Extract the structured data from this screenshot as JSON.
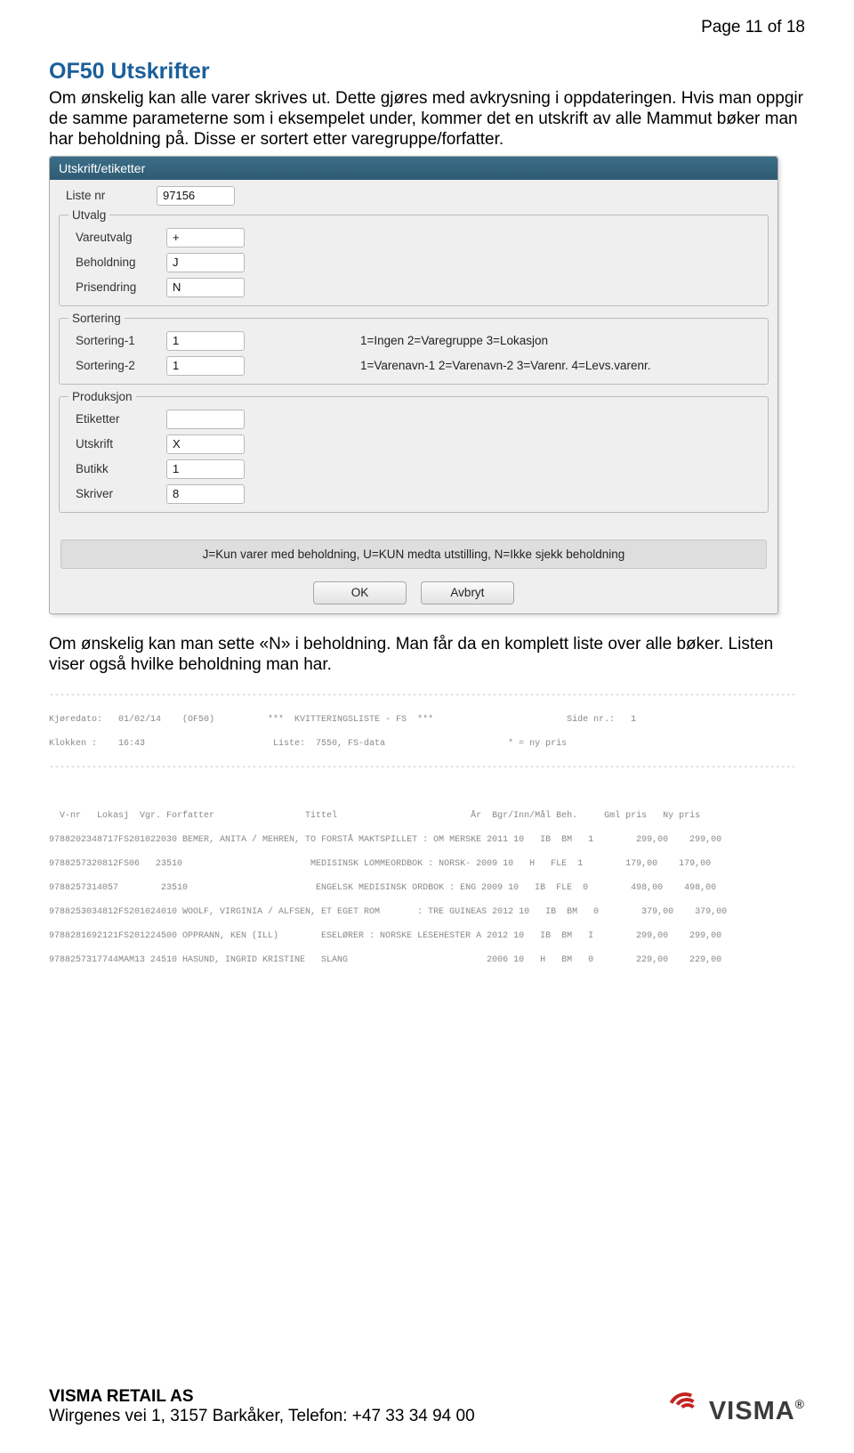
{
  "page_indicator": "Page 11 of 18",
  "heading": "OF50 Utskrifter",
  "para_top": "Om ønskelig kan alle varer skrives ut. Dette gjøres med avkrysning i oppdateringen. Hvis man oppgir de samme parameterne som i eksempelet under, kommer det en utskrift av alle Mammut bøker man har beholdning på. Disse er sortert etter varegruppe/forfatter.",
  "dialog": {
    "title": "Utskrift/etiketter",
    "liste_nr_label": "Liste nr",
    "liste_nr_value": "97156",
    "group_utvalg": {
      "legend": "Utvalg",
      "rows": [
        {
          "label": "Vareutvalg",
          "value": "+"
        },
        {
          "label": "Beholdning",
          "value": "J"
        },
        {
          "label": "Prisendring",
          "value": "N"
        }
      ]
    },
    "group_sortering": {
      "legend": "Sortering",
      "rows": [
        {
          "label": "Sortering-1",
          "value": "1",
          "hint": "1=Ingen  2=Varegruppe  3=Lokasjon"
        },
        {
          "label": "Sortering-2",
          "value": "1",
          "hint": "1=Varenavn-1  2=Varenavn-2  3=Varenr.  4=Levs.varenr."
        }
      ]
    },
    "group_produksjon": {
      "legend": "Produksjon",
      "rows": [
        {
          "label": "Etiketter",
          "value": ""
        },
        {
          "label": "Utskrift",
          "value": "X"
        },
        {
          "label": "Butikk",
          "value": "1"
        },
        {
          "label": "Skriver",
          "value": "8"
        }
      ]
    },
    "help_text": "J=Kun varer med beholdning, U=KUN medta utstilling, N=Ikke sjekk beholdning",
    "btn_ok": "OK",
    "btn_cancel": "Avbryt"
  },
  "para_mid": "Om ønskelig kan man sette «N» i beholdning. Man får da en komplett liste over alle bøker. Listen viser også hvilke beholdning man har.",
  "receipt": {
    "header1": "Kjøredato:   01/02/14    (OF50)          ***  KVITTERINGSLISTE - FS  ***                         Side nr.:   1",
    "header2": "Klokken :    16:43                        Liste:  7550, FS-data                       * = ny pris",
    "colhead": "  V-nr   Lokasj  Vgr. Forfatter                 Tittel                         År  Bgr/Inn/Mål Beh.     Gml pris   Ny pris",
    "rows": [
      "9788202348717FS201022030 BEMER, ANITA / MEHREN, TO FORSTÅ MAKTSPILLET : OM MERSKE 2011 10   IB  BM   1        299,00    299,00",
      "9788257320812FS06   23510                        MEDISINSK LOMMEORDBOK : NORSK- 2009 10   H   FLE  1        179,00    179,00",
      "9788257314057        23510                        ENGELSK MEDISINSK ORDBOK : ENG 2009 10   IB  FLE  0        498,00    498,00",
      "9788253034812FS201024010 WOOLF, VIRGINIA / ALFSEN, ET EGET ROM       : TRE GUINEAS 2012 10   IB  BM   0        379,00    379,00",
      "9788281692121FS201224500 OPPRANN, KEN (ILL)        ESELØRER : NORSKE LESEHESTER A 2012 10   IB  BM   I        299,00    299,00",
      "9788257317744MAM13 24510 HASUND, INGRID KRISTINE   SLANG                          2006 10   H   BM   0        229,00    229,00"
    ]
  },
  "footer": {
    "company": "VISMA RETAIL AS",
    "address": "Wirgenes vei 1, 3157 Barkåker, Telefon: +47 33 34 94 00",
    "logo_text": "VISMA"
  }
}
